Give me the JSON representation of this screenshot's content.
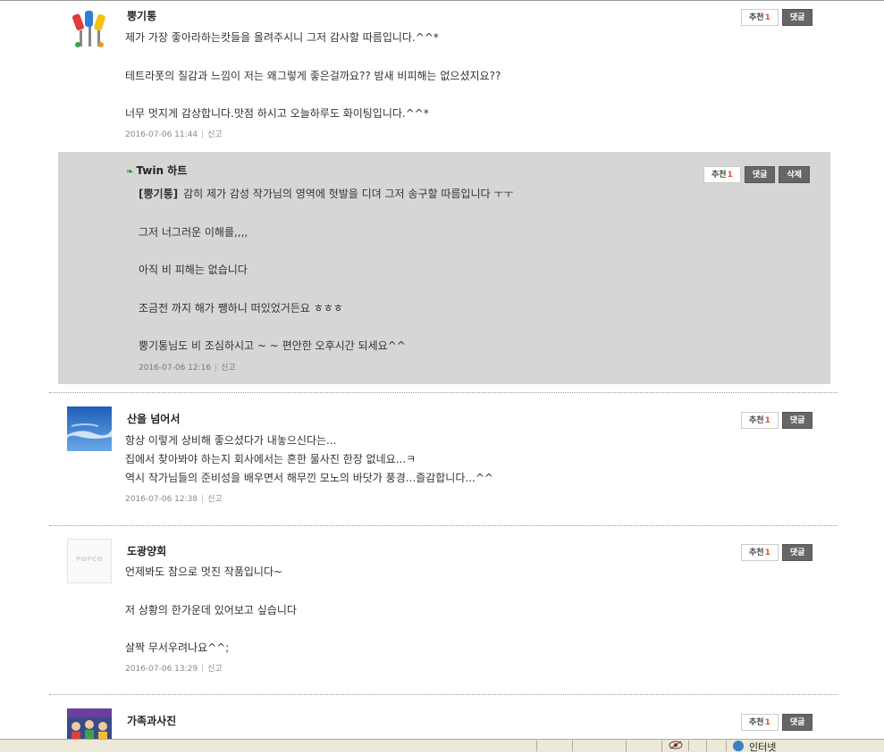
{
  "buttons": {
    "recommend": "추천",
    "reply": "댓글",
    "delete": "삭제"
  },
  "comments": [
    {
      "nick": "뿡기통",
      "lines": [
        "제가 가장 좋아라하는캇들을 올려주시니 그저 감사할 따름입니다.^^*",
        "테트라폿의 질감과 느낌이 저는 왜그렇게 좋은걸까요?? 밤새 비피해는 없으셨지요??",
        "너무 멋지게 감상합니다.맛점 하시고 오늘하루도 화이팅입니다.^^*"
      ],
      "date": "2016-07-06 11:44",
      "report": "신고",
      "recommend_count": "1"
    },
    {
      "nick": "산을 넘어서",
      "lines": [
        "항상 이렇게 상비해 좋으셨다가 내놓으신다는...",
        "집에서 찾아봐야 하는지 회사에서는 흔한 물사진 한장 없네요...ㅋ",
        "역시 작가님들의 준비성을 배우면서 해무낀 모노의 바닷가 풍경...즐감합니다...^^"
      ],
      "date": "2016-07-06 12:38",
      "report": "신고",
      "recommend_count": "1"
    },
    {
      "nick": "도광양회",
      "avatar_text": "POPCO",
      "lines": [
        "언제봐도 참으로 멋진 작품입니다~",
        "저 상황의 한가운데 있어보고 싶습니다",
        "살짝 무서우려나요^^;"
      ],
      "date": "2016-07-06 13:29",
      "report": "신고",
      "recommend_count": "1"
    },
    {
      "nick": "가족과사진",
      "date": "",
      "report": "",
      "recommend_count": "1"
    }
  ],
  "reply": {
    "nick": "Twin 하트",
    "tag": "[뿡기통]",
    "lines": [
      "감히 제가 감성 작가님의 영역에 헛발을 디뎌 그저 송구할 따름입니다 ㅜㅜ",
      "그저 너그러운 이해를,,,,",
      "아직 비 피해는 없습니다",
      "조금전 까지 해가 쨍하니 떠있었거든요 ㅎㅎㅎ",
      "뿡기통님도 비 조심하시고 ~ ~ 편안한 오후시간 되세요^^"
    ],
    "date": "2016-07-06 12:16",
    "report": "신고",
    "recommend_count": "1"
  },
  "statusbar": {
    "zone_label": "인터넷"
  }
}
